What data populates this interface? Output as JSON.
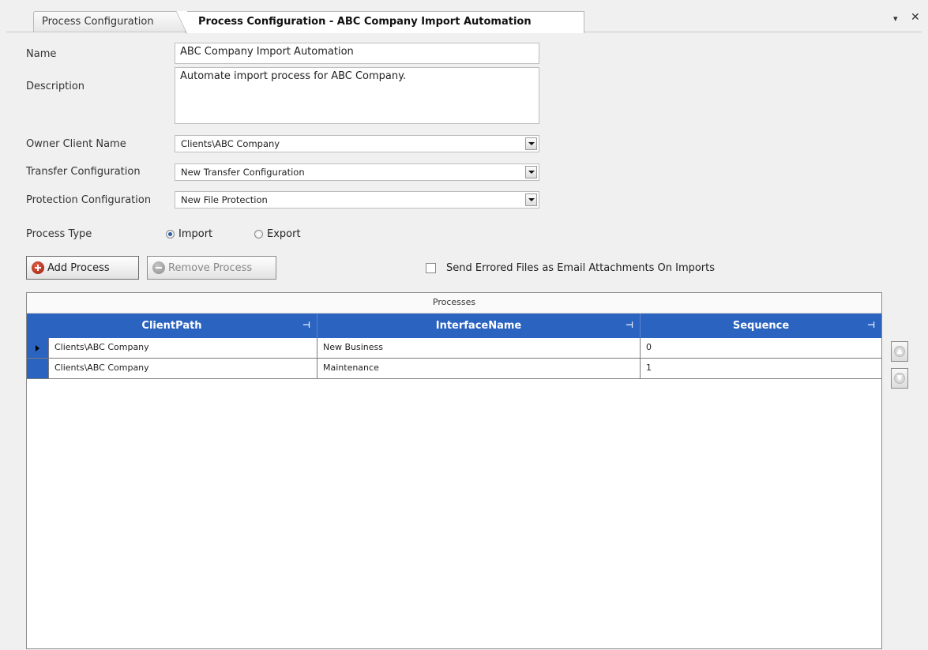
{
  "tabs": [
    {
      "label": "Process Configuration"
    },
    {
      "label": "Process Configuration - ABC Company Import Automation"
    }
  ],
  "window_controls": {
    "pin": "▾",
    "close": "✕"
  },
  "form": {
    "name_label": "Name",
    "name_value": "ABC Company Import Automation",
    "description_label": "Description",
    "description_value": "Automate import process for ABC Company.",
    "owner_label": "Owner Client Name",
    "owner_value": "Clients\\ABC Company",
    "transfer_label": "Transfer Configuration",
    "transfer_value": "New Transfer Configuration",
    "protection_label": "Protection Configuration",
    "protection_value": "New File Protection",
    "process_type_label": "Process Type",
    "process_type_options": [
      "Import",
      "Export"
    ],
    "process_type_selected": "Import"
  },
  "toolbar": {
    "add_label": "Add Process",
    "remove_label": "Remove Process",
    "email_checkbox_label": "Send Errored Files as Email Attachments On Imports",
    "email_checkbox_checked": false
  },
  "grid": {
    "caption": "Processes",
    "columns": [
      "ClientPath",
      "InterfaceName",
      "Sequence"
    ],
    "rows": [
      {
        "client_path": "Clients\\ABC Company",
        "interface_name": "New Business",
        "sequence": "0"
      },
      {
        "client_path": "Clients\\ABC Company",
        "interface_name": "Maintenance",
        "sequence": "1"
      }
    ]
  },
  "colors": {
    "grid_header": "#2b63c0",
    "add_icon": "#b02818"
  },
  "icons": {
    "move_up": "arrow-up-icon",
    "move_down": "arrow-down-icon",
    "column_pin": "pin-icon"
  }
}
